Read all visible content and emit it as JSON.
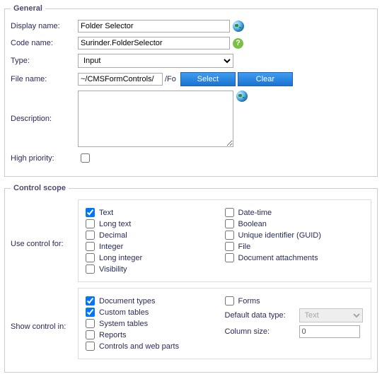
{
  "general": {
    "legend": "General",
    "displayName": {
      "label": "Display name:",
      "value": "Folder Selector"
    },
    "codeName": {
      "label": "Code name:",
      "value": "Surinder.FolderSelector"
    },
    "type": {
      "label": "Type:",
      "value": "Input"
    },
    "fileName": {
      "label": "File name:",
      "value": "~/CMSFormControls/",
      "suffix": "/Fo"
    },
    "buttons": {
      "select": "Select",
      "clear": "Clear"
    },
    "description": {
      "label": "Description:",
      "value": ""
    },
    "highPriority": {
      "label": "High priority:",
      "checked": false
    }
  },
  "scope": {
    "legend": "Control scope",
    "useControlFor": {
      "label": "Use control for:",
      "left": [
        {
          "label": "Text",
          "checked": true
        },
        {
          "label": "Long text",
          "checked": false
        },
        {
          "label": "Decimal",
          "checked": false
        },
        {
          "label": "Integer",
          "checked": false
        },
        {
          "label": "Long integer",
          "checked": false
        },
        {
          "label": "Visibility",
          "checked": false
        }
      ],
      "right": [
        {
          "label": "Date-time",
          "checked": false
        },
        {
          "label": "Boolean",
          "checked": false
        },
        {
          "label": "Unique identifier (GUID)",
          "checked": false
        },
        {
          "label": "File",
          "checked": false
        },
        {
          "label": "Document attachments",
          "checked": false
        }
      ]
    },
    "showControlIn": {
      "label": "Show control in:",
      "left": [
        {
          "label": "Document types",
          "checked": true
        },
        {
          "label": "Custom tables",
          "checked": true
        },
        {
          "label": "System tables",
          "checked": false
        },
        {
          "label": "Reports",
          "checked": false
        },
        {
          "label": "Controls and web parts",
          "checked": false
        }
      ],
      "rightForms": {
        "label": "Forms",
        "checked": false
      },
      "defaultDataType": {
        "label": "Default data type:",
        "value": "Text"
      },
      "columnSize": {
        "label": "Column size:",
        "value": "0"
      }
    }
  }
}
